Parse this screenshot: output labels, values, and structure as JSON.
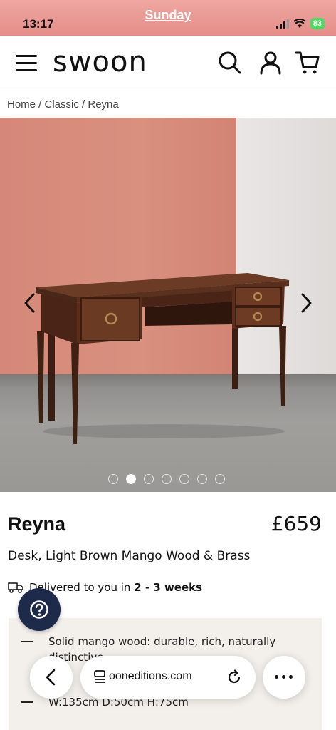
{
  "status_bar": {
    "time": "13:17",
    "center_label": "Sunday",
    "battery": "83"
  },
  "header": {
    "logo": "swoon",
    "icons": [
      "menu-icon",
      "search-icon",
      "account-icon",
      "cart-icon"
    ]
  },
  "breadcrumb": "Home / Classic / Reyna",
  "gallery": {
    "image_count": 7,
    "active_index": 1
  },
  "product": {
    "name": "Reyna",
    "price": "£659",
    "subtitle": "Desk, Light Brown Mango Wood & Brass",
    "delivery_prefix": "Delivered to you in ",
    "delivery_time": "2 - 3 weeks",
    "features": [
      "Solid mango wood: durable, rich, naturally distinctive",
      "W:135cm D:50cm H:75cm"
    ]
  },
  "browser": {
    "url": "ooneditions.com"
  },
  "colors": {
    "status_bar": "#e48d88",
    "help_button": "#1e2a4a",
    "features_bg": "#f3f0ec",
    "battery": "#4cd964"
  }
}
